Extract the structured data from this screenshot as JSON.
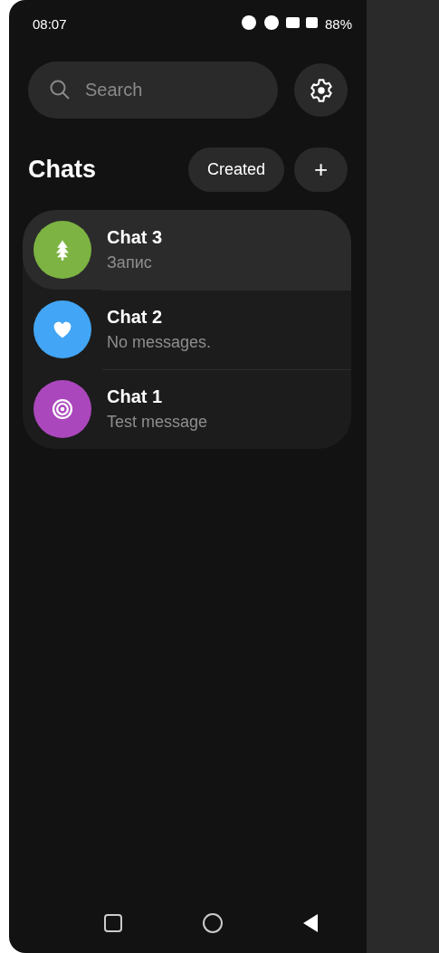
{
  "status_bar": {
    "time": "08:07",
    "battery": "88%"
  },
  "search": {
    "placeholder": "Search"
  },
  "header": {
    "title": "Chats",
    "filter_button": "Created",
    "add_button": "+"
  },
  "chats": [
    {
      "name": "Chat 3",
      "preview": "Запис",
      "selected": true,
      "color": "#7cb342",
      "kind": "tree"
    },
    {
      "name": "Chat 2",
      "preview": "No messages.",
      "selected": false,
      "color": "#42a5f5",
      "kind": "heart"
    },
    {
      "name": "Chat 1",
      "preview": "Test message",
      "selected": false,
      "color": "#ab47bc",
      "kind": "target"
    }
  ]
}
